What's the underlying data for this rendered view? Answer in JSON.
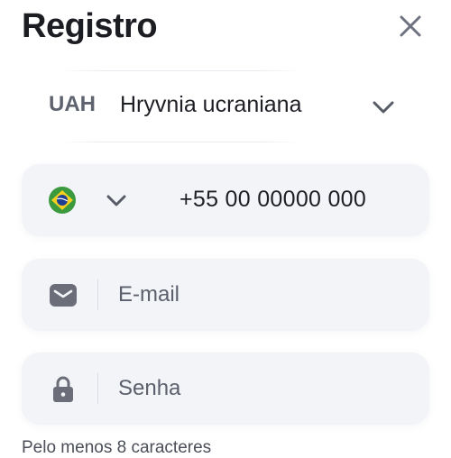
{
  "header": {
    "title": "Registro",
    "close_icon": "close-icon"
  },
  "currency": {
    "code": "UAH",
    "name": "Hryvnia ucraniana",
    "chevron_icon": "chevron-down-icon"
  },
  "phone": {
    "country_flag": "brazil-flag-icon",
    "value": "+55 00 00000 000"
  },
  "email": {
    "icon": "envelope-icon",
    "placeholder": "E-mail"
  },
  "password": {
    "icon": "lock-icon",
    "placeholder": "Senha"
  },
  "hint": "Pelo menos 8 caracteres",
  "colors": {
    "field_background": "#f3f4f8",
    "icon_gray": "#6b6e79",
    "text_dark": "#1e1f24"
  }
}
